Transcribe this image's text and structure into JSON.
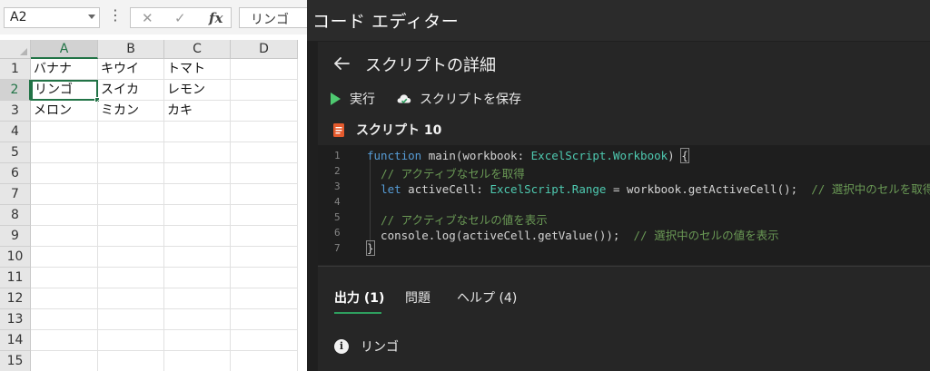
{
  "excel": {
    "name_box": "A2",
    "formula_bar": {
      "cancel_icon": "✕",
      "enter_icon": "✓",
      "fx_label": "fx",
      "value": "リンゴ"
    },
    "columns": [
      "A",
      "B",
      "C",
      "D"
    ],
    "rows": [
      "1",
      "2",
      "3",
      "4",
      "5",
      "6",
      "7",
      "8",
      "9",
      "10",
      "11",
      "12",
      "13",
      "14",
      "15"
    ],
    "cells": [
      [
        "バナナ",
        "キウイ",
        "トマト"
      ],
      [
        "リンゴ",
        "スイカ",
        "レモン"
      ],
      [
        "メロン",
        "ミカン",
        "カキ"
      ]
    ],
    "active_cell": "A2",
    "accent_color": "#217346"
  },
  "editor": {
    "window_title": "コード エディター",
    "page_title": "スクリプトの詳細",
    "run_label": "実行",
    "save_label": "スクリプトを保存",
    "script_name": "スクリプト 10",
    "code_lines": [
      {
        "n": "1",
        "text": "function main(workbook: ExcelScript.Workbook) {"
      },
      {
        "n": "2",
        "text": "  // アクティブなセルを取得"
      },
      {
        "n": "3",
        "text": "  let activeCell: ExcelScript.Range = workbook.getActiveCell();  // 選択中のセルを取得"
      },
      {
        "n": "4",
        "text": ""
      },
      {
        "n": "5",
        "text": "  // アクティブなセルの値を表示"
      },
      {
        "n": "6",
        "text": "  console.log(activeCell.getValue());  // 選択中のセルの値を表示"
      },
      {
        "n": "7",
        "text": "}"
      }
    ],
    "tabs": [
      {
        "label": "出力 (1)",
        "active": true
      },
      {
        "label": "問題",
        "active": false
      },
      {
        "label": "ヘルプ (4)",
        "active": false
      }
    ],
    "output": {
      "icon": "info-icon",
      "text": "リンゴ"
    },
    "colors": {
      "run_green": "#4ec970",
      "tab_underline": "#2e9e5e",
      "keyword": "#569cd6",
      "type": "#4ec9b0",
      "comment": "#6a9955"
    }
  }
}
